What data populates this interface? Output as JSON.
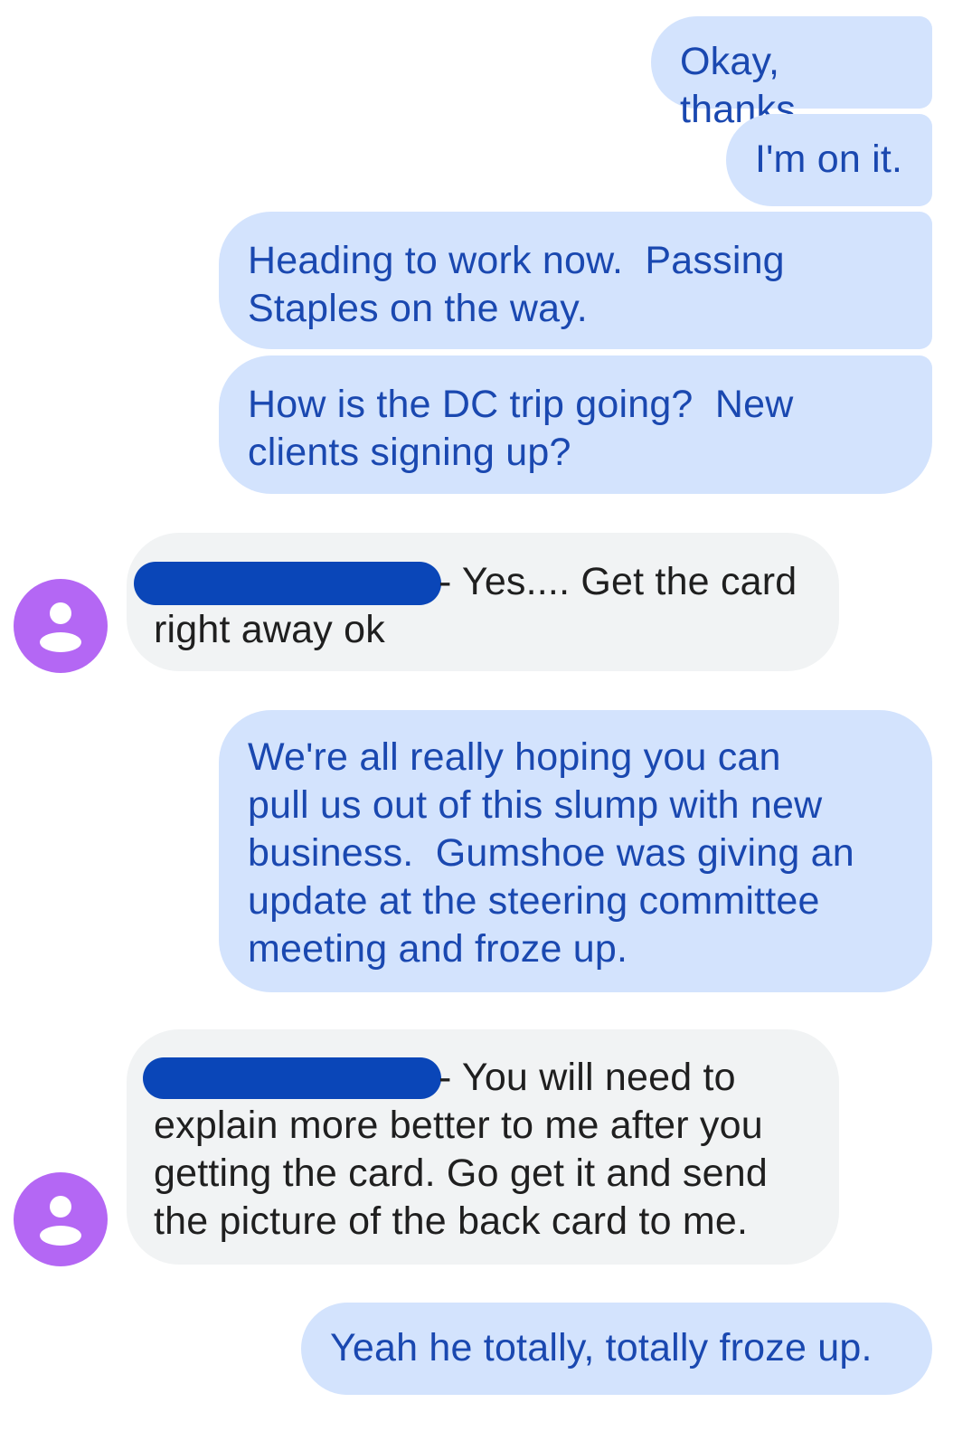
{
  "messages": [
    {
      "direction": "outgoing",
      "text": "Okay, thanks"
    },
    {
      "direction": "outgoing",
      "text": "I'm on it."
    },
    {
      "direction": "outgoing",
      "text": "Heading to work now.  Passing\nStaples on the way."
    },
    {
      "direction": "outgoing",
      "text": "How is the DC trip going?  New\nclients signing up?"
    },
    {
      "direction": "incoming",
      "sender_redacted": true,
      "text_line1": "- Yes.... Get the card",
      "text_rest": "right away ok"
    },
    {
      "direction": "outgoing",
      "text": "We're all really hoping you can\npull us out of this slump with new\nbusiness.  Gumshoe was giving an\nupdate at the steering committee\nmeeting and froze up."
    },
    {
      "direction": "incoming",
      "sender_redacted": true,
      "text_line1": "- You will need to",
      "text_rest": "explain more better to me after you\ngetting the card. Go get it and send\nthe picture of the back card to me."
    },
    {
      "direction": "outgoing",
      "text": "Yeah he totally, totally froze up."
    }
  ],
  "colors": {
    "outgoing_bubble": "#d3e3fd",
    "outgoing_text": "#1a48b0",
    "incoming_bubble": "#f1f3f4",
    "incoming_text": "#1f1f1f",
    "avatar": "#b467f4",
    "redaction": "#0a46b8"
  },
  "icons": {
    "avatar": "person-icon"
  }
}
